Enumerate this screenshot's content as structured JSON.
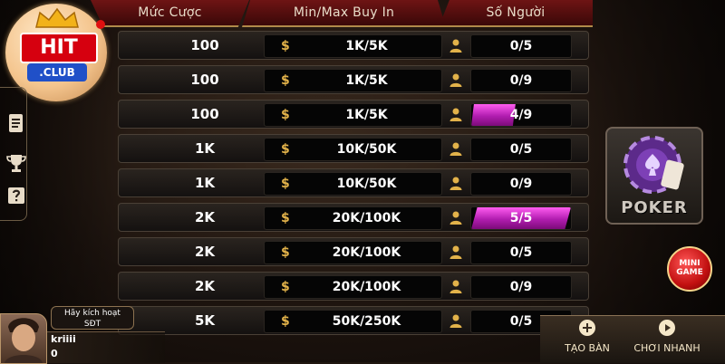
{
  "logo": {
    "main": "HIT",
    "sub": ".CLUB"
  },
  "header": {
    "col_bet": "Mức Cược",
    "col_buyin": "Min/Max Buy In",
    "col_players": "Số Người"
  },
  "rows": [
    {
      "bet": "100",
      "buyin": "1K/5K",
      "players": "0/5",
      "fill": 0
    },
    {
      "bet": "100",
      "buyin": "1K/5K",
      "players": "0/9",
      "fill": 0
    },
    {
      "bet": "100",
      "buyin": "1K/5K",
      "players": "4/9",
      "fill": 0.444
    },
    {
      "bet": "1K",
      "buyin": "10K/50K",
      "players": "0/5",
      "fill": 0
    },
    {
      "bet": "1K",
      "buyin": "10K/50K",
      "players": "0/9",
      "fill": 0
    },
    {
      "bet": "2K",
      "buyin": "20K/100K",
      "players": "5/5",
      "fill": 1.0
    },
    {
      "bet": "2K",
      "buyin": "20K/100K",
      "players": "0/5",
      "fill": 0
    },
    {
      "bet": "2K",
      "buyin": "20K/100K",
      "players": "0/9",
      "fill": 0
    },
    {
      "bet": "5K",
      "buyin": "50K/250K",
      "players": "0/5",
      "fill": 0
    }
  ],
  "currency_symbol": "$",
  "game_tile": {
    "label": "POKER"
  },
  "mini_game": {
    "line1": "MINI",
    "line2": "GAME"
  },
  "bottom": {
    "create_table": "TẠO BÀN",
    "quick_play": "CHƠI NHANH"
  },
  "profile": {
    "activate_line1": "Hãy kích hoạt",
    "activate_line2": "SĐT",
    "username": "kriiii",
    "balance": "0"
  },
  "colors": {
    "header_red": "#6e1414",
    "accent_gold": "#e2b24a",
    "fill_magenta": "#d12ad0"
  }
}
